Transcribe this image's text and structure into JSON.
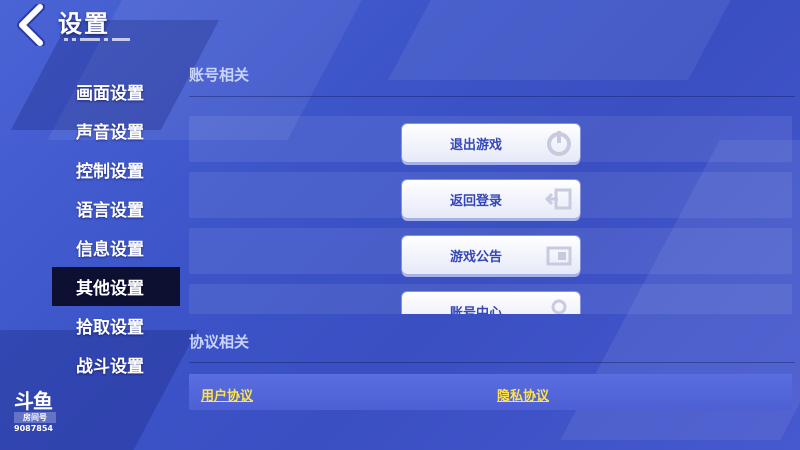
{
  "header": {
    "title": "设置"
  },
  "menu": {
    "items": [
      {
        "label": "画面设置"
      },
      {
        "label": "声音设置"
      },
      {
        "label": "控制设置"
      },
      {
        "label": "语言设置"
      },
      {
        "label": "信息设置"
      },
      {
        "label": "其他设置",
        "active": true
      },
      {
        "label": "拾取设置"
      },
      {
        "label": "战斗设置"
      }
    ]
  },
  "account": {
    "title": "账号相关",
    "buttons": [
      {
        "label": "退出游戏",
        "icon": "power-icon"
      },
      {
        "label": "返回登录",
        "icon": "logout-icon"
      },
      {
        "label": "游戏公告",
        "icon": "notice-icon"
      },
      {
        "label": "账号中心",
        "icon": "user-icon"
      }
    ]
  },
  "agreement": {
    "title": "协议相关",
    "user_link": "用户协议",
    "privacy_link": "隐私协议"
  },
  "watermark": {
    "logo": "斗鱼",
    "tag": "房间号",
    "room": "9087854"
  },
  "colors": {
    "background": "#3c55c9",
    "menu_active": "#0d1030",
    "button_text": "#3446b8",
    "link": "#ffe24a"
  }
}
